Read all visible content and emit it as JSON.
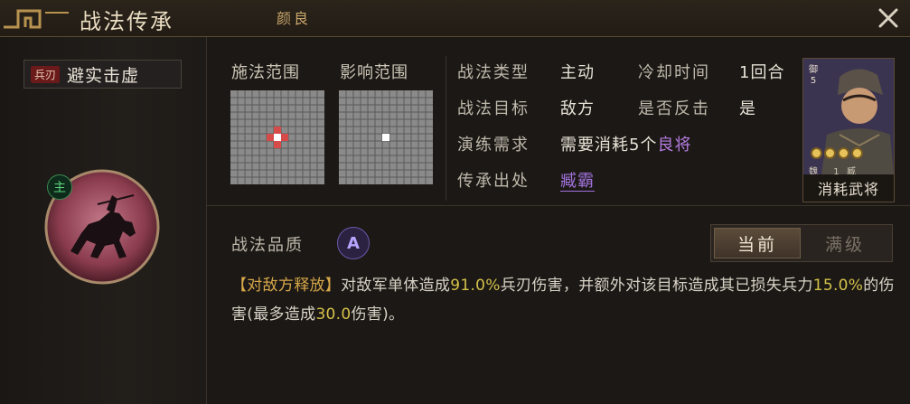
{
  "header": {
    "title": "战法传承",
    "hero_name": "颜良"
  },
  "skill": {
    "type_tag": "兵刃",
    "name": "避实击虚",
    "role_badge": "主"
  },
  "ranges": {
    "cast_label": "施法范围",
    "effect_label": "影响范围"
  },
  "info": {
    "type_label": "战法类型",
    "type_value": "主动",
    "cooldown_label": "冷却时间",
    "cooldown_value": "1回合",
    "target_label": "战法目标",
    "target_value": "敌方",
    "counter_label": "是否反击",
    "counter_value": "是",
    "drill_label": "演练需求",
    "drill_prefix": "需要消耗",
    "drill_count": "5",
    "drill_unit": "个",
    "drill_item": "良将",
    "source_label": "传承出处",
    "source_value": "臧霸"
  },
  "card": {
    "cost": "御",
    "cost_num": "5",
    "faction": "魏",
    "level": "1",
    "general": "臧霸",
    "footer": "消耗武将"
  },
  "quality": {
    "label": "战法品质",
    "grade": "A"
  },
  "toggle": {
    "current": "当前",
    "max": "满级"
  },
  "description": {
    "tag": "【对敌方释放】",
    "p1": "对敌军单体造成",
    "v1": "91.0%",
    "p2": "兵刃伤害，并额外对该目标造成其已损失兵力",
    "v2": "15.0%",
    "p3": "的伤害(最多造成",
    "v3": "30.0",
    "p4": "伤害)。"
  },
  "colors": {
    "purple": "#b57be0",
    "highlight": "#d4c14a",
    "tag": "#d8a84a"
  }
}
